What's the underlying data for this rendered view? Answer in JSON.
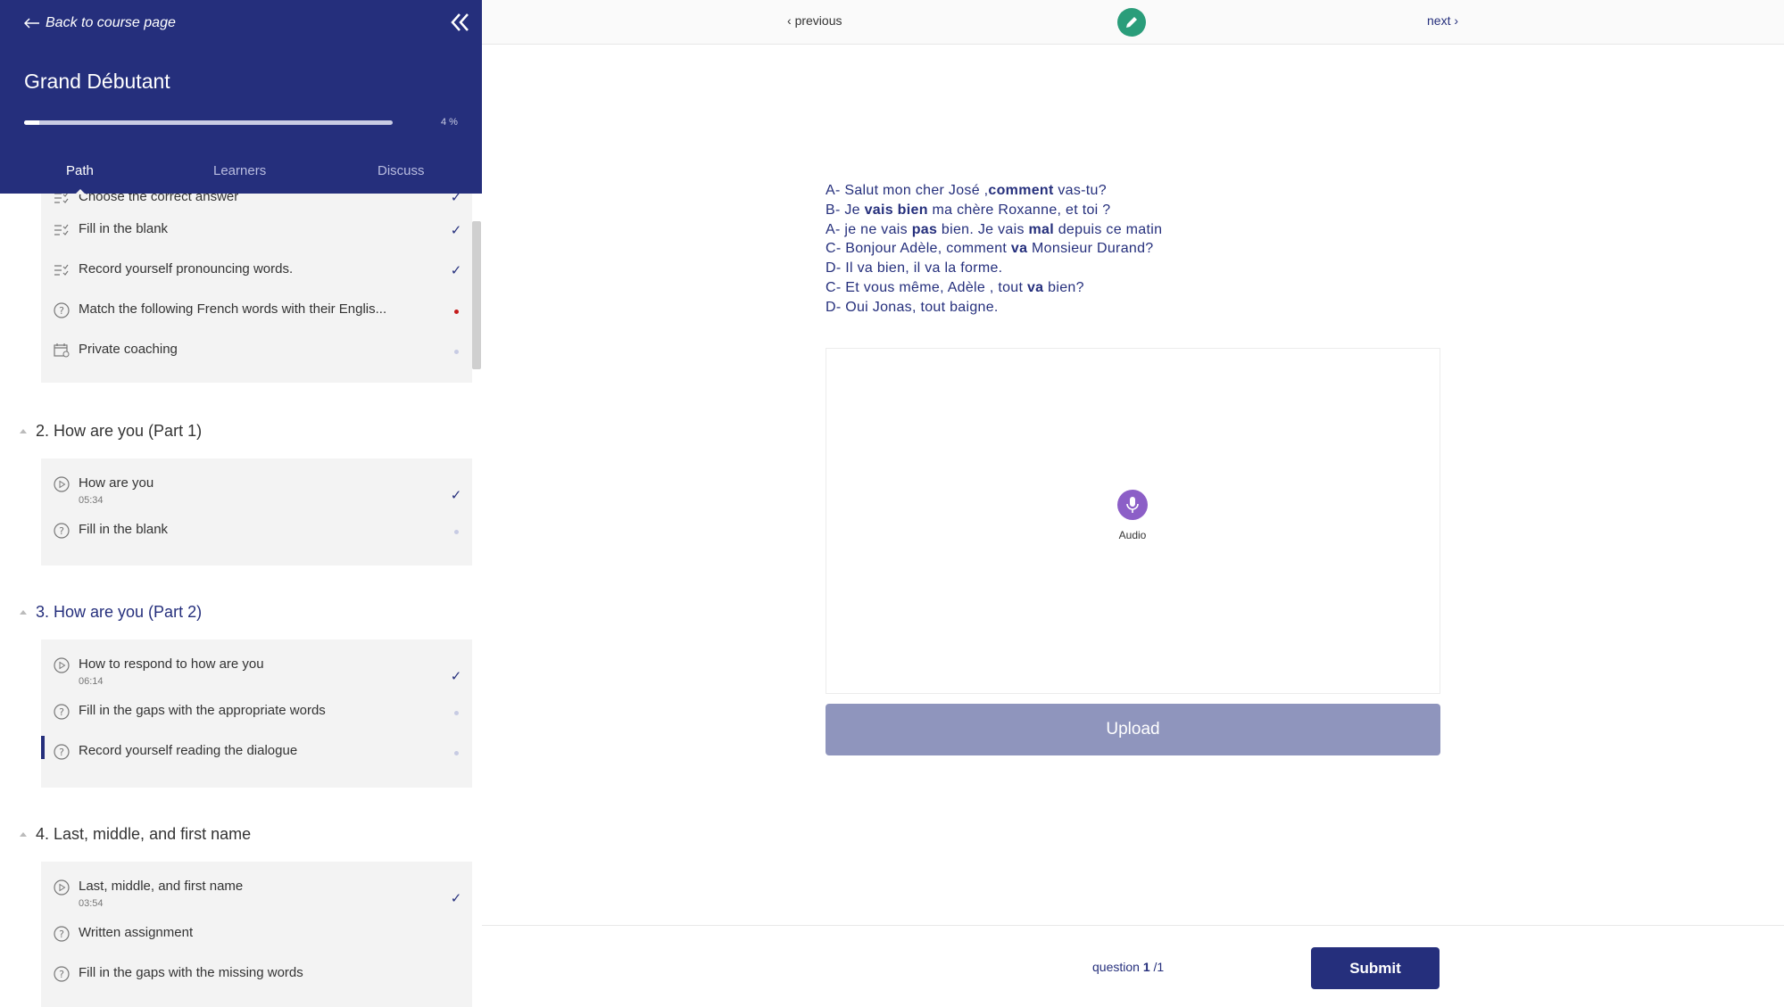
{
  "sidebar": {
    "back_label": "Back to course page",
    "course_title": "Grand Débutant",
    "progress_label": "4 %",
    "progress_fraction": 0.04,
    "tabs": [
      {
        "label": "Path"
      },
      {
        "label": "Learners"
      },
      {
        "label": "Discuss"
      }
    ],
    "group1": {
      "items": [
        {
          "label": "Choose the correct answer",
          "icon": "checklist-icon",
          "status": "✓"
        },
        {
          "label": "Fill in the blank",
          "icon": "checklist-icon",
          "status": "✓"
        },
        {
          "label": "Record yourself pronouncing words.",
          "icon": "checklist-icon",
          "status": "✓"
        },
        {
          "label": "Match the following French words with their Englis...",
          "icon": "question-icon"
        },
        {
          "label": "Private coaching",
          "icon": "calendar-icon"
        }
      ]
    },
    "sections": [
      {
        "title": "2. How are you (Part 1)",
        "items": [
          {
            "label": "How are you",
            "duration": "05:34",
            "status": "✓"
          },
          {
            "label": "Fill in the blank"
          }
        ]
      },
      {
        "title": "3. How are you (Part 2)",
        "items": [
          {
            "label": "How to respond to how are you",
            "duration": "06:14",
            "status": "✓"
          },
          {
            "label": "Fill in the gaps with the appropriate words"
          },
          {
            "label": "Record yourself reading the dialogue"
          }
        ]
      },
      {
        "title": "4. Last, middle, and first name",
        "items": [
          {
            "label": "Last, middle, and first name",
            "duration": "03:54",
            "status": "✓"
          },
          {
            "label": "Written assignment"
          },
          {
            "label": "Fill in the gaps with the missing words"
          }
        ]
      }
    ]
  },
  "topbar": {
    "previous_label": "previous",
    "next_label": "next"
  },
  "dialogue": [
    {
      "segments": [
        {
          "t": "A- Salut mon cher José ,"
        },
        {
          "t": "comment",
          "b": true
        },
        {
          "t": " vas-tu?"
        }
      ]
    },
    {
      "segments": [
        {
          "t": "B- Je "
        },
        {
          "t": "vais bien",
          "b": true
        },
        {
          "t": " ma chère Roxanne, et toi ?"
        }
      ]
    },
    {
      "segments": [
        {
          "t": "A- je ne vais "
        },
        {
          "t": "pas",
          "b": true
        },
        {
          "t": " bien. Je vais "
        },
        {
          "t": "mal",
          "b": true
        },
        {
          "t": " depuis ce matin"
        }
      ]
    },
    {
      "segments": [
        {
          "t": "C- Bonjour Adèle, comment "
        },
        {
          "t": "va",
          "b": true
        },
        {
          "t": " Monsieur Durand?"
        }
      ]
    },
    {
      "segments": [
        {
          "t": "D- Il va bien, il va  la forme."
        }
      ]
    },
    {
      "segments": [
        {
          "t": "C- Et vous même, Adèle , tout "
        },
        {
          "t": "va",
          "b": true
        },
        {
          "t": " bien?"
        }
      ]
    },
    {
      "segments": [
        {
          "t": "D- Oui Jonas, tout baigne."
        }
      ]
    }
  ],
  "recorder": {
    "audio_label": "Audio",
    "upload_label": "Upload"
  },
  "footer": {
    "question_word": "question",
    "current": "1",
    "total": "/1",
    "submit_label": "Submit"
  },
  "colors": {
    "brand": "#252f7c",
    "upload_disabled": "#8f95bd",
    "edit": "#2a9d7a",
    "audio": "#8c5fc7",
    "pending_red": "#c41b1b"
  }
}
